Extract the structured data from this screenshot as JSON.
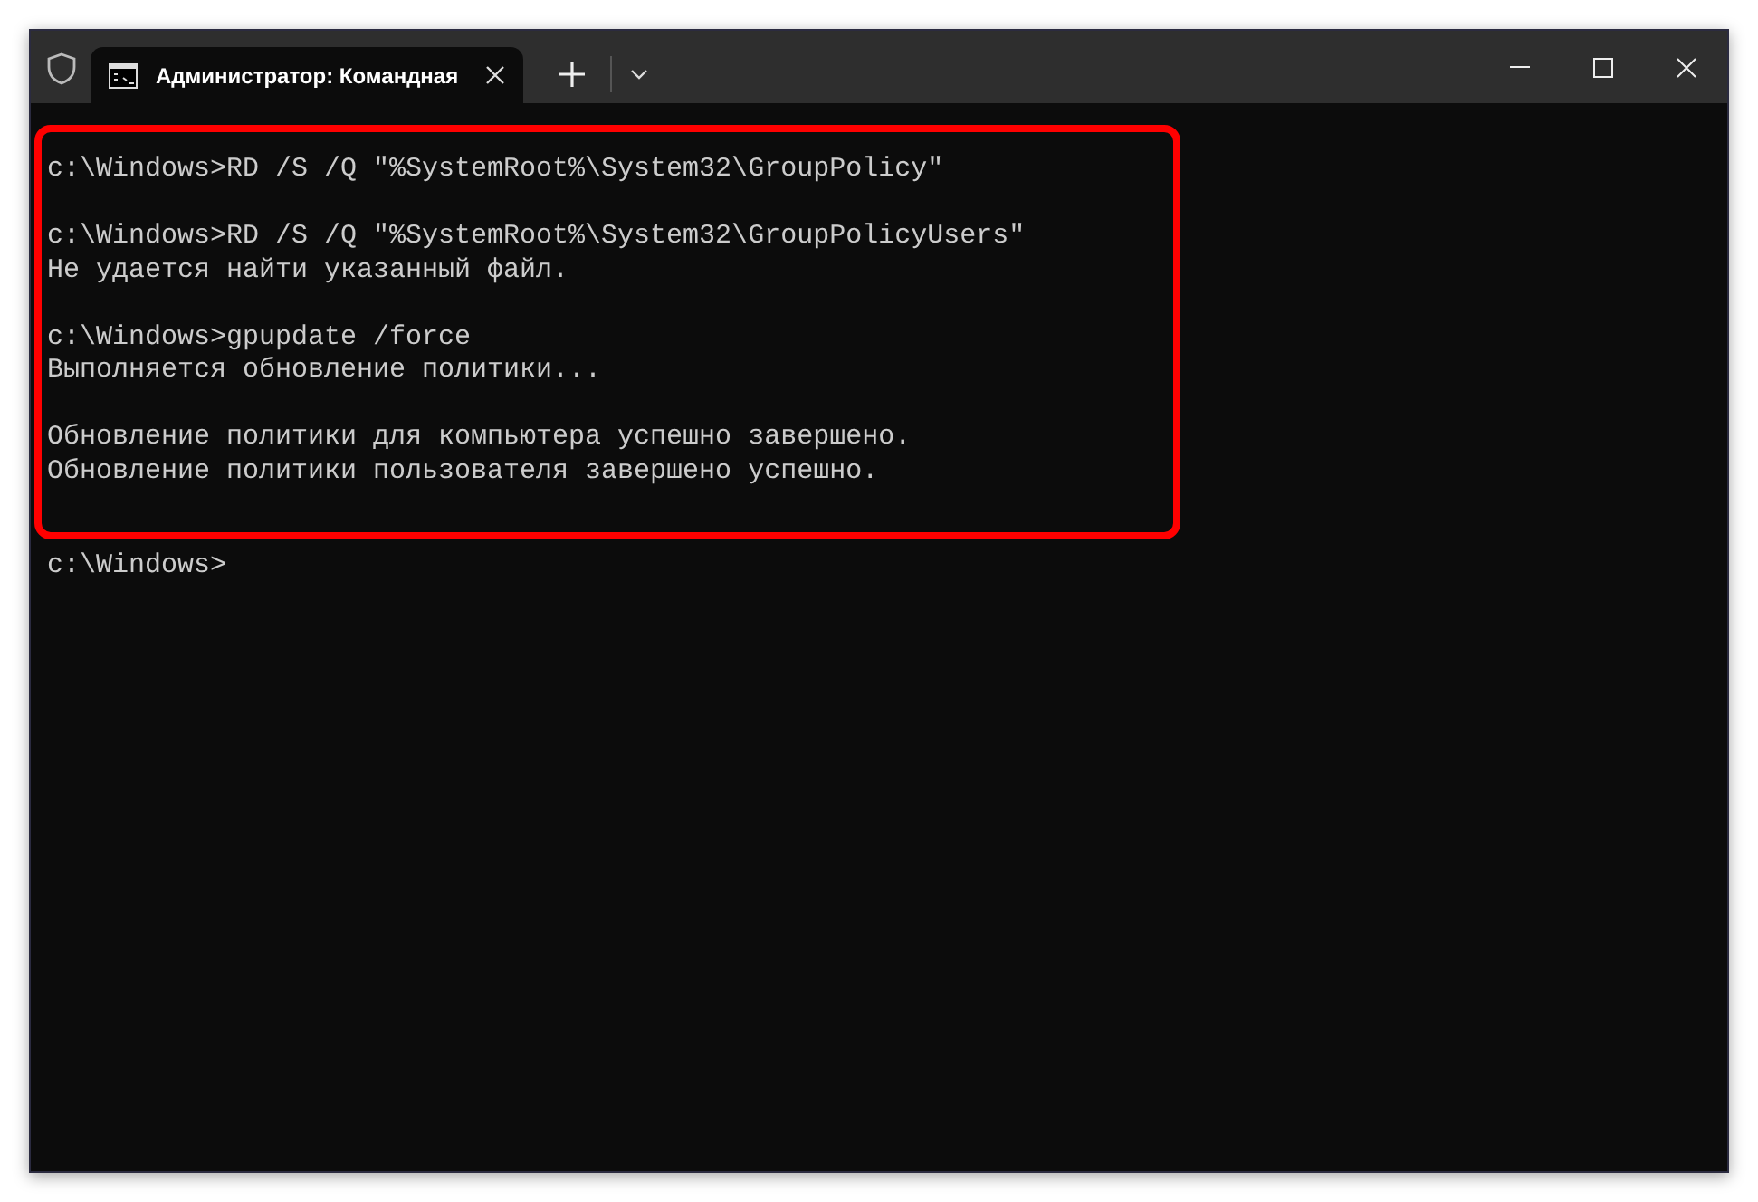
{
  "window": {
    "tab_title": "Администратор: Командная"
  },
  "terminal": {
    "blocks": [
      {
        "highlighted": true,
        "paragraphs": [
          [
            "c:\\Windows>RD /S /Q \"%SystemRoot%\\System32\\GroupPolicy\""
          ],
          [
            "c:\\Windows>RD /S /Q \"%SystemRoot%\\System32\\GroupPolicyUsers\"",
            "Не удается найти указанный файл."
          ],
          [
            "c:\\Windows>gpupdate /force",
            "Выполняется обновление политики..."
          ],
          [
            "Обновление политики для компьютера успешно завершено.",
            "Обновление политики пользователя завершено успешно."
          ]
        ]
      },
      {
        "highlighted": false,
        "paragraphs": [
          [
            "c:\\Windows>"
          ]
        ]
      }
    ]
  }
}
